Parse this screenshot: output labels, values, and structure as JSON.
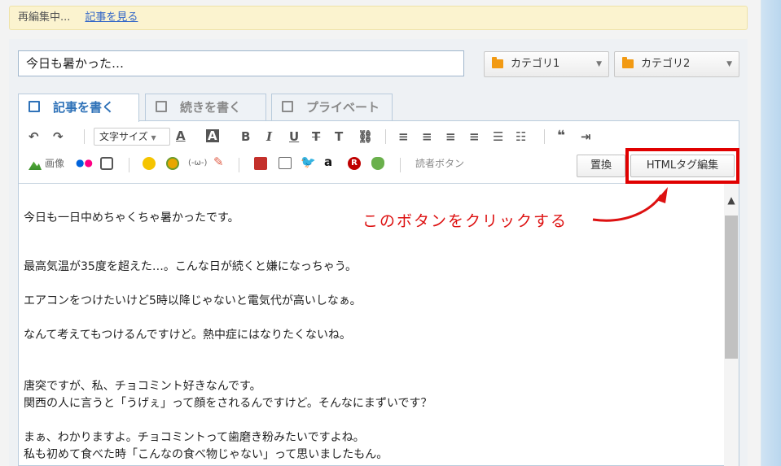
{
  "status": {
    "text": "再編集中...",
    "link": "記事を見る"
  },
  "title_value": "今日も暑かった…",
  "categories": [
    "カテゴリ1",
    "カテゴリ2"
  ],
  "tabs": [
    "記事を書く",
    "続きを書く",
    "プライベート"
  ],
  "toolbar": {
    "font_size": "文字サイズ",
    "image_label": "画像",
    "reader_button": "読者ボタン",
    "replace_button": "置換",
    "html_edit_button": "HTMLタグ編集"
  },
  "annotation": "このボタンをクリックする",
  "body_lines": [
    "今日も一日中めちゃくちゃ暑かったです。",
    "最高気温が35度を超えた…。こんな日が続くと嫌になっちゃう。",
    "エアコンをつけたいけど5時以降じゃないと電気代が高いしなぁ。",
    "なんて考えてもつけるんですけど。熱中症にはなりたくないね。",
    "唐突ですが、私、チョコミント好きなんです。",
    "関西の人に言うと「うげぇ」って顔をされるんですけど。そんなにまずいです？",
    "まぁ、わかりますよ。チョコミントって歯磨き粉みたいですよね。",
    "私も初めて食べた時「こんなの食べ物じゃない」って思いましたもん。"
  ],
  "colors": {
    "accent": "#2f72b8",
    "highlight": "#e00000",
    "folder": "#f29a13"
  }
}
